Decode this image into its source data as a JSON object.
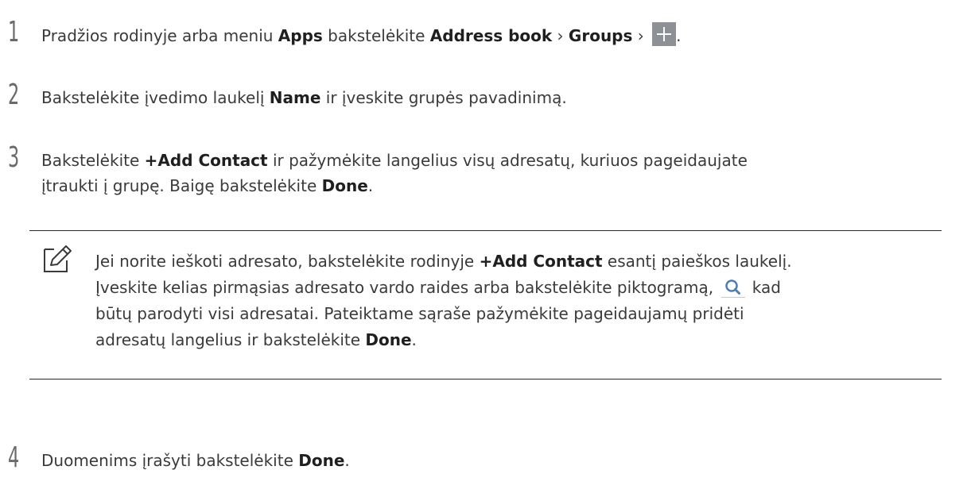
{
  "steps": [
    {
      "number": "1",
      "parts": {
        "t1": "Pradžios rodinyje arba meniu ",
        "b1": "Apps",
        "t2": " bakstelėkite ",
        "b2": "Address book",
        "t3": " › ",
        "b3": "Groups",
        "t4": " › ",
        "t5": "."
      },
      "icon": "plus-icon"
    },
    {
      "number": "2",
      "parts": {
        "t1": "Bakstelėkite įvedimo laukelį ",
        "b1": "Name",
        "t2": " ir įveskite grupės pavadinimą."
      }
    },
    {
      "number": "3",
      "line1": {
        "t1": "Bakstelėkite ",
        "b1": "+Add Contact",
        "t2": " ir pažymėkite langelius visų adresatų, kuriuos pageidaujate"
      },
      "line2": {
        "t1": "įtraukti į grupę. Baigę bakstelėkite ",
        "b1": "Done",
        "t2": "."
      }
    },
    {
      "number": "4",
      "parts": {
        "t1": "Duomenims įrašyti bakstelėkite ",
        "b1": "Done",
        "t2": "."
      }
    }
  ],
  "note": {
    "icon": "pencil-note-icon",
    "line1": {
      "t1": "Jei norite ieškoti adresato, bakstelėkite rodinyje ",
      "b1": "+Add Contact",
      "t2": " esantį paieškos laukelį."
    },
    "line2": {
      "t1": "Įveskite kelias pirmąsias adresato vardo raides arba bakstelėkite piktogramą, ",
      "t2": " kad"
    },
    "line3": {
      "t1": "būtų parodyti visi adresatai. Pateiktame sąraše pažymėkite pageidaujamų pridėti"
    },
    "line4": {
      "t1": "adresatų langelius ir bakstelėkite ",
      "b1": "Done",
      "t2": "."
    },
    "search_icon": "search-icon"
  },
  "colors": {
    "text": "#3a3a3a",
    "bold_text": "#1f1f1f",
    "plus_button_bg": "#8d9196",
    "search_icon": "#4a7fb8",
    "rule": "#2a2a2a"
  }
}
